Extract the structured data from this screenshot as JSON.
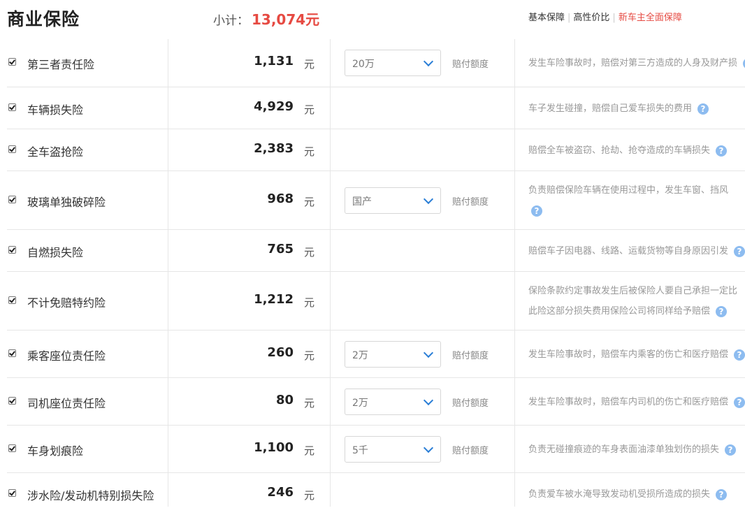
{
  "header": {
    "title": "商业保险",
    "subtotal_label": "小计：",
    "subtotal_value": "13,074元",
    "links": [
      "基本保障",
      "高性价比",
      "新车主全面保障"
    ]
  },
  "rows": [
    {
      "name": "第三者责任险",
      "price": "1,131",
      "unit": "元",
      "select": "20万",
      "limit_label": "赔付额度",
      "desc": [
        "发生车险事故时，赔偿对第三方造成的人身及财产损"
      ]
    },
    {
      "name": "车辆损失险",
      "price": "4,929",
      "unit": "元",
      "desc": [
        "车子发生碰撞，赔偿自己爱车损失的费用"
      ]
    },
    {
      "name": "全车盗抢险",
      "price": "2,383",
      "unit": "元",
      "desc": [
        "赔偿全车被盗窃、抢劫、抢夺造成的车辆损失"
      ]
    },
    {
      "name": "玻璃单独破碎险",
      "price": "968",
      "unit": "元",
      "select": "国产",
      "limit_label": "赔付额度",
      "desc": [
        "负责赔偿保险车辆在使用过程中，发生车窗、挡风"
      ]
    },
    {
      "name": "自燃损失险",
      "price": "765",
      "unit": "元",
      "desc": [
        "赔偿车子因电器、线路、运载货物等自身原因引发"
      ]
    },
    {
      "name": "不计免赔特约险",
      "price": "1,212",
      "unit": "元",
      "desc": [
        "保险条款约定事故发生后被保险人要自己承担一定比",
        "此险这部分损失费用保险公司将同样给予赔偿"
      ]
    },
    {
      "name": "乘客座位责任险",
      "price": "260",
      "unit": "元",
      "select": "2万",
      "limit_label": "赔付额度",
      "desc": [
        "发生车险事故时，赔偿车内乘客的伤亡和医疗赔偿"
      ]
    },
    {
      "name": "司机座位责任险",
      "price": "80",
      "unit": "元",
      "select": "2万",
      "limit_label": "赔付额度",
      "desc": [
        "发生车险事故时，赔偿车内司机的伤亡和医疗赔偿"
      ]
    },
    {
      "name": "车身划痕险",
      "price": "1,100",
      "unit": "元",
      "select": "5千",
      "limit_label": "赔付额度",
      "desc": [
        "负责无碰撞痕迹的车身表面油漆单独划伤的损失"
      ]
    },
    {
      "name": "涉水险/发动机特别损失险",
      "price": "246",
      "unit": "元",
      "desc": [
        "负责爱车被水淹导致发动机受损所造成的损失"
      ]
    }
  ]
}
